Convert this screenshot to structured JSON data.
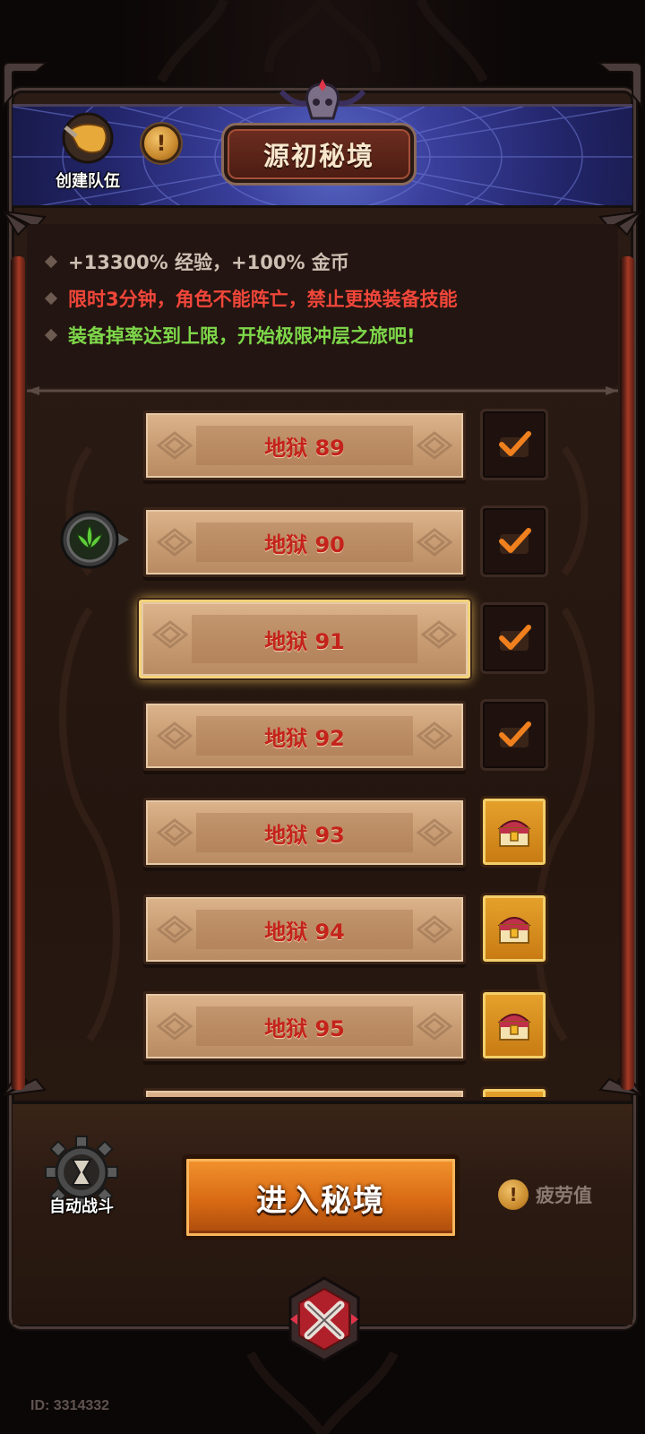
{
  "header": {
    "title": "源初秘境",
    "create_team_label": "创建队伍",
    "info_icon": "exclamation-icon"
  },
  "rules": [
    "+13300% 经验，+100% 金币",
    "限时3分钟，角色不能阵亡，禁止更换装备技能",
    "装备掉率达到上限，开始极限冲层之旅吧!"
  ],
  "levels": [
    {
      "name": "地狱 89",
      "status": "completed"
    },
    {
      "name": "地狱 90",
      "status": "completed",
      "current": true
    },
    {
      "name": "地狱 91",
      "status": "completed",
      "selected": true
    },
    {
      "name": "地狱 92",
      "status": "completed"
    },
    {
      "name": "地狱 93",
      "status": "reward-chest"
    },
    {
      "name": "地狱 94",
      "status": "reward-chest"
    },
    {
      "name": "地狱 95",
      "status": "reward-chest"
    }
  ],
  "bottom": {
    "auto_battle_label": "自动战斗",
    "enter_button_label": "进入秘境",
    "fatigue_label": "疲劳值"
  },
  "footer": {
    "user_id": "ID: 3314332"
  },
  "colors": {
    "header_blue": "#3a3f9c",
    "rule_neutral": "#cdbfb2",
    "rule_warning": "#f0463a",
    "rule_positive": "#7ed74a",
    "level_text": "#c4231b",
    "enter_button": "#d86a14"
  }
}
